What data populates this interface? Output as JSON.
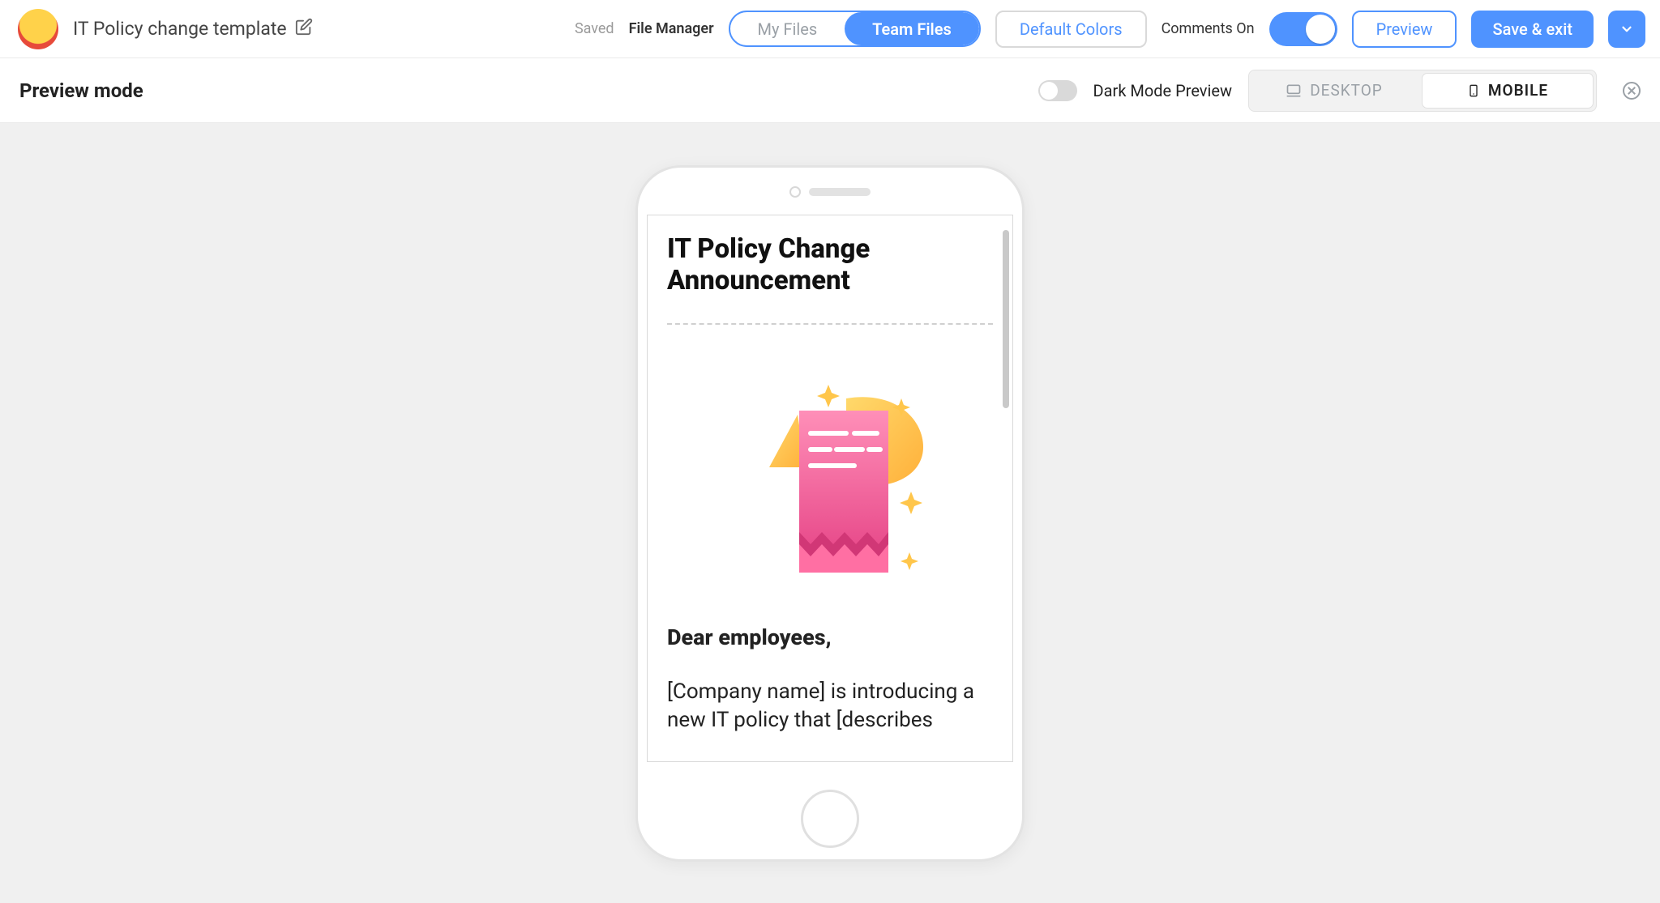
{
  "header": {
    "doc_title": "IT Policy change template",
    "saved_label": "Saved",
    "file_manager_label": "File Manager",
    "files_seg": {
      "my_files": "My Files",
      "team_files": "Team Files"
    },
    "default_colors": "Default Colors",
    "comments_on": "Comments On",
    "preview_btn": "Preview",
    "save_exit": "Save & exit"
  },
  "subbar": {
    "preview_mode": "Preview mode",
    "dark_mode_label": "Dark Mode Preview",
    "device": {
      "desktop": "DESKTOP",
      "mobile": "MOBILE"
    }
  },
  "email": {
    "title": "IT Policy Change Announcement",
    "greeting": "Dear employees,",
    "body": "[Company name] is introducing a new IT policy that [describes"
  },
  "colors": {
    "primary": "#4f93ff",
    "canvas_bg": "#f0f0f0"
  }
}
